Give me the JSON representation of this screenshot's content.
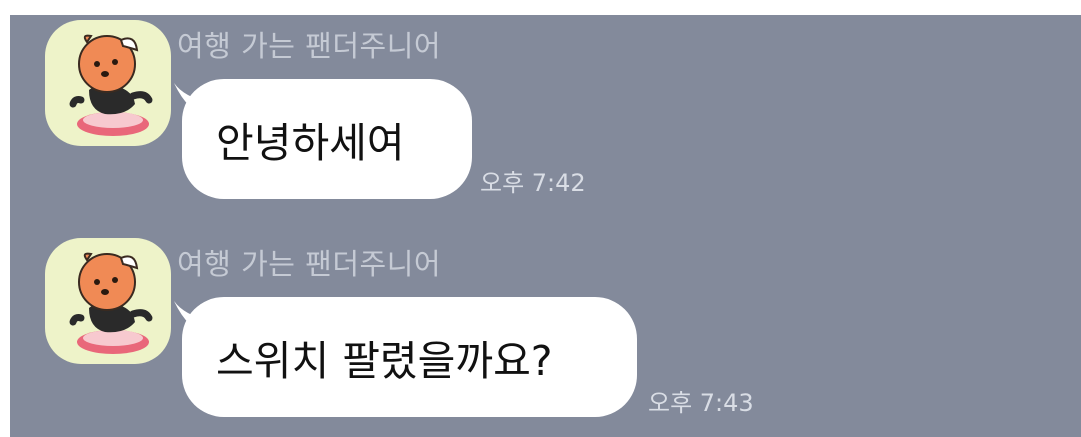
{
  "chat": {
    "messages": [
      {
        "sender": "여행 가는 팬더주니어",
        "text": "안녕하세여",
        "time": "오후 7:42",
        "avatar_icon": "panda-character-avatar-icon"
      },
      {
        "sender": "여행 가는 팬더주니어",
        "text": "스위치 팔렸을까요?",
        "time": "오후 7:43",
        "avatar_icon": "panda-character-avatar-icon"
      }
    ]
  },
  "colors": {
    "chat_background": "#838a9b",
    "bubble": "#ffffff",
    "avatar_background": "#eef3c9",
    "sender_text": "#c5cad4",
    "time_text": "#d9dde5"
  }
}
